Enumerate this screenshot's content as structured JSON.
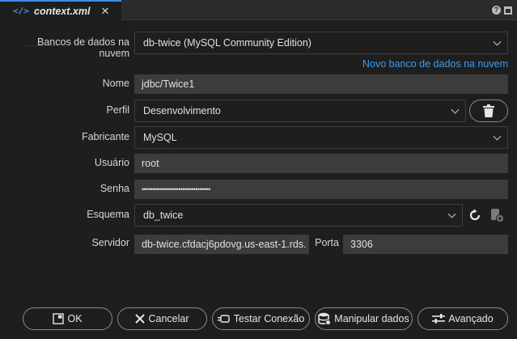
{
  "tab": {
    "title": "context.xml",
    "code_glyph": "</>",
    "close_glyph": "✕"
  },
  "form": {
    "cloud_db": {
      "label": "Bancos de dados na nuvem",
      "value": "db-twice (MySQL Community Edition)"
    },
    "new_cloud_db_link": "Novo banco de dados na nuvem",
    "name": {
      "label": "Nome",
      "value": "jdbc/Twice1"
    },
    "profile": {
      "label": "Perfil",
      "value": "Desenvolvimento"
    },
    "vendor": {
      "label": "Fabricante",
      "value": "MySQL"
    },
    "user": {
      "label": "Usuário",
      "value": "root"
    },
    "password": {
      "label": "Senha",
      "value": "••••••••••••••••••••••••••••••••"
    },
    "schema": {
      "label": "Esquema",
      "value": "db_twice"
    },
    "server": {
      "label": "Servidor",
      "value": "db-twice.cfdacj6pdovg.us-east-1.rds."
    },
    "port": {
      "label": "Porta",
      "value": "3306"
    }
  },
  "buttons": {
    "ok": "OK",
    "cancel": "Cancelar",
    "test": "Testar Conexão",
    "manipulate": "Manipular dados",
    "advanced": "Avançado"
  },
  "colors": {
    "accent": "#3b8eea",
    "link": "#3b9cf0",
    "field_bg": "#3c3c3c",
    "background": "#1e1e1e"
  }
}
